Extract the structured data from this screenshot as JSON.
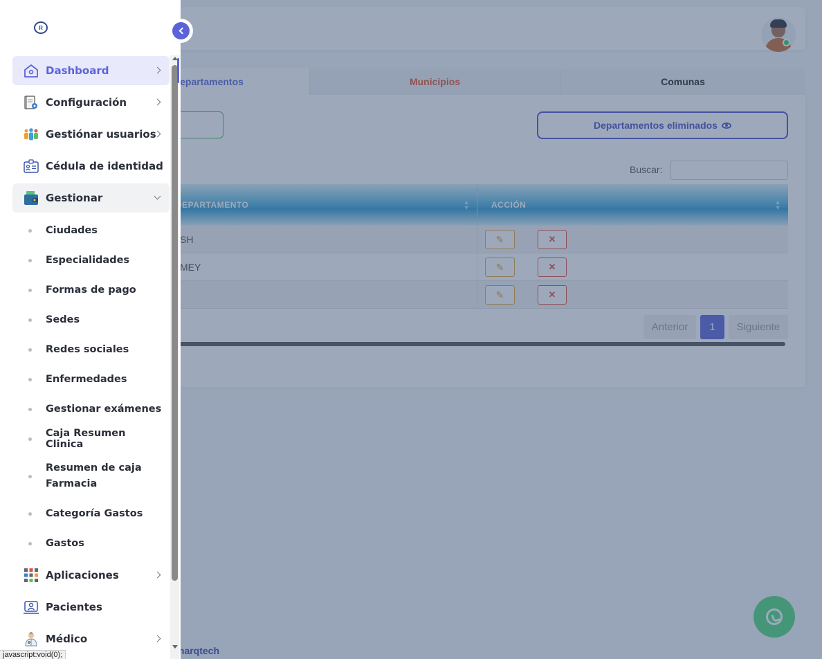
{
  "tabs": {
    "departamentos": "Departamentos",
    "municipios": "Municipios",
    "comunas": "Comunas"
  },
  "main": {
    "deleted_button": "Departamentos eliminados",
    "search_label": "Buscar:",
    "search_value": "",
    "table": {
      "headers": [
        "DEPARTAMENTO",
        "ACCIÓN"
      ],
      "rows": [
        {
          "departamento": "SH"
        },
        {
          "departamento": "MEY"
        },
        {
          "departamento": ""
        }
      ]
    },
    "pagination": {
      "prev": "Anterior",
      "current": "1",
      "next": "Siguiente"
    }
  },
  "footer": {
    "brand": "marqtech"
  },
  "sidebar": {
    "items": [
      {
        "label": "Dashboard",
        "icon": "home-icon"
      },
      {
        "label": "Configuración",
        "icon": "settings-notebook-icon"
      },
      {
        "label": "Gestiónar usuarios",
        "icon": "users-group-icon"
      },
      {
        "label": "Cédula de identidad",
        "icon": "id-card-icon"
      },
      {
        "label": "Gestionar",
        "icon": "wallet-icon"
      }
    ],
    "sub_items": [
      "Ciudades",
      "Especialidades",
      "Formas de pago",
      "Sedes",
      "Redes sociales",
      "Enfermedades",
      "Gestionar exámenes",
      "Caja Resumen Clinica",
      "Resumen de caja Farmacia",
      "Categoría Gastos",
      "Gastos"
    ],
    "items_after": [
      {
        "label": "Aplicaciones",
        "icon": "apps-grid-icon"
      },
      {
        "label": "Pacientes",
        "icon": "patient-icon"
      },
      {
        "label": "Médico",
        "icon": "doctor-icon"
      }
    ]
  },
  "status_bar": "javascript:void(0);",
  "colors": {
    "accent": "#5b63d8",
    "municipios_tab": "#e0542e",
    "whatsapp": "#4fd87a",
    "overlay": "rgba(60,84,118,0.5)"
  }
}
